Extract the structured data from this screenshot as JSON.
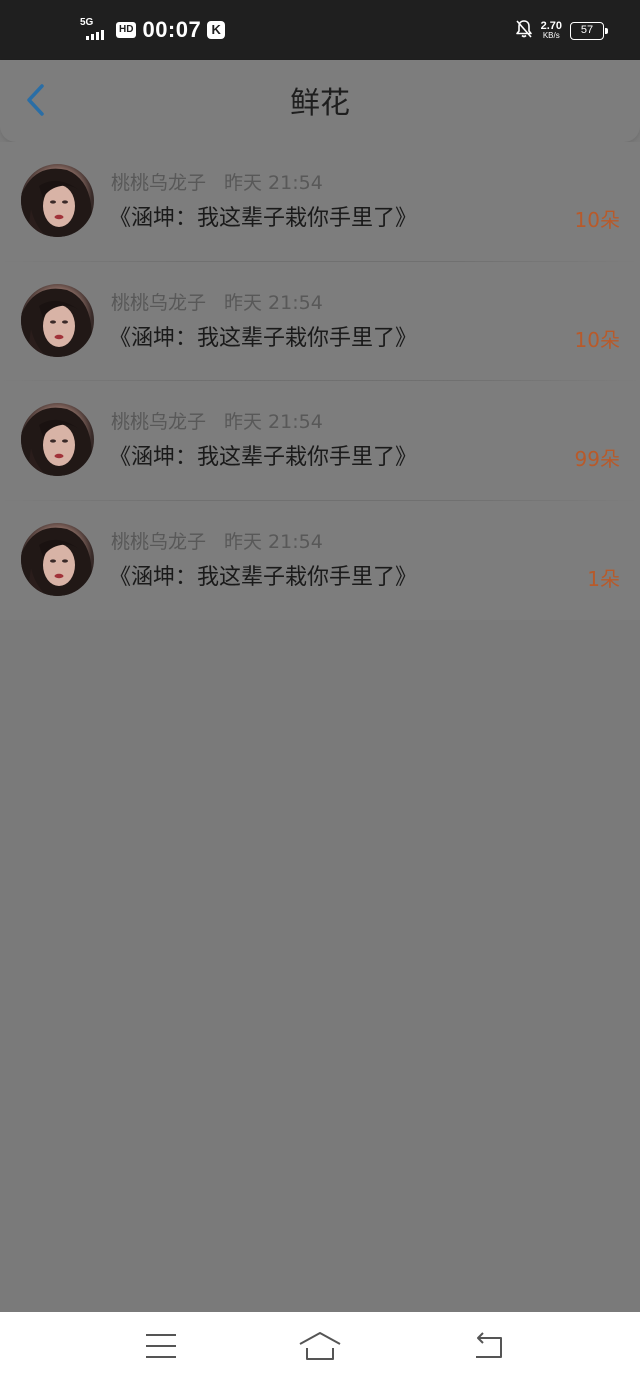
{
  "status_bar": {
    "network": "5G",
    "hd_badge": "HD",
    "time": "00:07",
    "app_badge": "K",
    "speed_value": "2.70",
    "speed_unit": "KB/s",
    "battery": "57"
  },
  "header": {
    "title": "鲜花"
  },
  "list": [
    {
      "username": "桃桃乌龙子",
      "time": "昨天 21:54",
      "message": "《涵坤：我这辈子栽你手里了》",
      "count": "10朵"
    },
    {
      "username": "桃桃乌龙子",
      "time": "昨天 21:54",
      "message": "《涵坤：我这辈子栽你手里了》",
      "count": "10朵"
    },
    {
      "username": "桃桃乌龙子",
      "time": "昨天 21:54",
      "message": "《涵坤：我这辈子栽你手里了》",
      "count": "99朵"
    },
    {
      "username": "桃桃乌龙子",
      "time": "昨天 21:54",
      "message": "《涵坤：我这辈子栽你手里了》",
      "count": "1朵"
    }
  ],
  "colors": {
    "accent_back": "#2a6ea6",
    "count_text": "#b85a2a",
    "overlay_bg": "#7a7a7a"
  }
}
